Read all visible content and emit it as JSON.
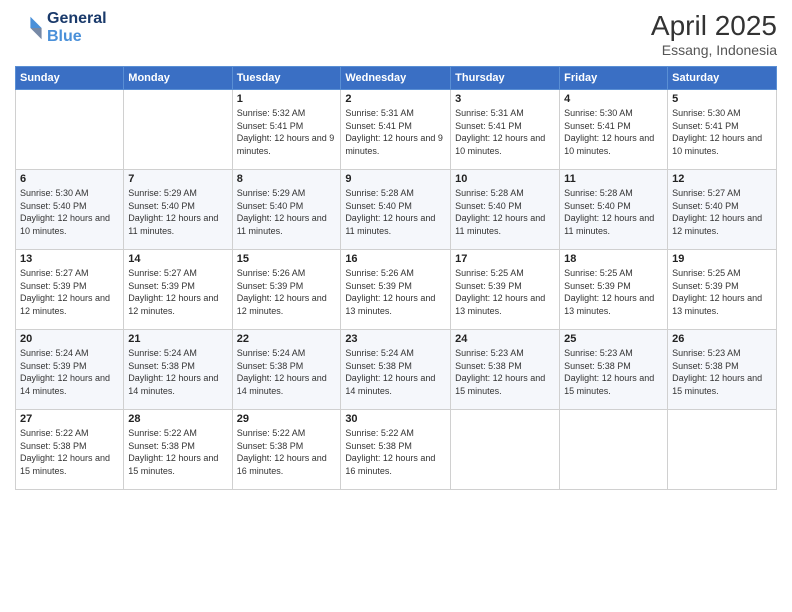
{
  "logo": {
    "line1": "General",
    "line2": "Blue"
  },
  "title": "April 2025",
  "subtitle": "Essang, Indonesia",
  "days_header": [
    "Sunday",
    "Monday",
    "Tuesday",
    "Wednesday",
    "Thursday",
    "Friday",
    "Saturday"
  ],
  "weeks": [
    [
      {
        "day": "",
        "sunrise": "",
        "sunset": "",
        "daylight": ""
      },
      {
        "day": "",
        "sunrise": "",
        "sunset": "",
        "daylight": ""
      },
      {
        "day": "1",
        "sunrise": "Sunrise: 5:32 AM",
        "sunset": "Sunset: 5:41 PM",
        "daylight": "Daylight: 12 hours and 9 minutes."
      },
      {
        "day": "2",
        "sunrise": "Sunrise: 5:31 AM",
        "sunset": "Sunset: 5:41 PM",
        "daylight": "Daylight: 12 hours and 9 minutes."
      },
      {
        "day": "3",
        "sunrise": "Sunrise: 5:31 AM",
        "sunset": "Sunset: 5:41 PM",
        "daylight": "Daylight: 12 hours and 10 minutes."
      },
      {
        "day": "4",
        "sunrise": "Sunrise: 5:30 AM",
        "sunset": "Sunset: 5:41 PM",
        "daylight": "Daylight: 12 hours and 10 minutes."
      },
      {
        "day": "5",
        "sunrise": "Sunrise: 5:30 AM",
        "sunset": "Sunset: 5:41 PM",
        "daylight": "Daylight: 12 hours and 10 minutes."
      }
    ],
    [
      {
        "day": "6",
        "sunrise": "Sunrise: 5:30 AM",
        "sunset": "Sunset: 5:40 PM",
        "daylight": "Daylight: 12 hours and 10 minutes."
      },
      {
        "day": "7",
        "sunrise": "Sunrise: 5:29 AM",
        "sunset": "Sunset: 5:40 PM",
        "daylight": "Daylight: 12 hours and 11 minutes."
      },
      {
        "day": "8",
        "sunrise": "Sunrise: 5:29 AM",
        "sunset": "Sunset: 5:40 PM",
        "daylight": "Daylight: 12 hours and 11 minutes."
      },
      {
        "day": "9",
        "sunrise": "Sunrise: 5:28 AM",
        "sunset": "Sunset: 5:40 PM",
        "daylight": "Daylight: 12 hours and 11 minutes."
      },
      {
        "day": "10",
        "sunrise": "Sunrise: 5:28 AM",
        "sunset": "Sunset: 5:40 PM",
        "daylight": "Daylight: 12 hours and 11 minutes."
      },
      {
        "day": "11",
        "sunrise": "Sunrise: 5:28 AM",
        "sunset": "Sunset: 5:40 PM",
        "daylight": "Daylight: 12 hours and 11 minutes."
      },
      {
        "day": "12",
        "sunrise": "Sunrise: 5:27 AM",
        "sunset": "Sunset: 5:40 PM",
        "daylight": "Daylight: 12 hours and 12 minutes."
      }
    ],
    [
      {
        "day": "13",
        "sunrise": "Sunrise: 5:27 AM",
        "sunset": "Sunset: 5:39 PM",
        "daylight": "Daylight: 12 hours and 12 minutes."
      },
      {
        "day": "14",
        "sunrise": "Sunrise: 5:27 AM",
        "sunset": "Sunset: 5:39 PM",
        "daylight": "Daylight: 12 hours and 12 minutes."
      },
      {
        "day": "15",
        "sunrise": "Sunrise: 5:26 AM",
        "sunset": "Sunset: 5:39 PM",
        "daylight": "Daylight: 12 hours and 12 minutes."
      },
      {
        "day": "16",
        "sunrise": "Sunrise: 5:26 AM",
        "sunset": "Sunset: 5:39 PM",
        "daylight": "Daylight: 12 hours and 13 minutes."
      },
      {
        "day": "17",
        "sunrise": "Sunrise: 5:25 AM",
        "sunset": "Sunset: 5:39 PM",
        "daylight": "Daylight: 12 hours and 13 minutes."
      },
      {
        "day": "18",
        "sunrise": "Sunrise: 5:25 AM",
        "sunset": "Sunset: 5:39 PM",
        "daylight": "Daylight: 12 hours and 13 minutes."
      },
      {
        "day": "19",
        "sunrise": "Sunrise: 5:25 AM",
        "sunset": "Sunset: 5:39 PM",
        "daylight": "Daylight: 12 hours and 13 minutes."
      }
    ],
    [
      {
        "day": "20",
        "sunrise": "Sunrise: 5:24 AM",
        "sunset": "Sunset: 5:39 PM",
        "daylight": "Daylight: 12 hours and 14 minutes."
      },
      {
        "day": "21",
        "sunrise": "Sunrise: 5:24 AM",
        "sunset": "Sunset: 5:38 PM",
        "daylight": "Daylight: 12 hours and 14 minutes."
      },
      {
        "day": "22",
        "sunrise": "Sunrise: 5:24 AM",
        "sunset": "Sunset: 5:38 PM",
        "daylight": "Daylight: 12 hours and 14 minutes."
      },
      {
        "day": "23",
        "sunrise": "Sunrise: 5:24 AM",
        "sunset": "Sunset: 5:38 PM",
        "daylight": "Daylight: 12 hours and 14 minutes."
      },
      {
        "day": "24",
        "sunrise": "Sunrise: 5:23 AM",
        "sunset": "Sunset: 5:38 PM",
        "daylight": "Daylight: 12 hours and 15 minutes."
      },
      {
        "day": "25",
        "sunrise": "Sunrise: 5:23 AM",
        "sunset": "Sunset: 5:38 PM",
        "daylight": "Daylight: 12 hours and 15 minutes."
      },
      {
        "day": "26",
        "sunrise": "Sunrise: 5:23 AM",
        "sunset": "Sunset: 5:38 PM",
        "daylight": "Daylight: 12 hours and 15 minutes."
      }
    ],
    [
      {
        "day": "27",
        "sunrise": "Sunrise: 5:22 AM",
        "sunset": "Sunset: 5:38 PM",
        "daylight": "Daylight: 12 hours and 15 minutes."
      },
      {
        "day": "28",
        "sunrise": "Sunrise: 5:22 AM",
        "sunset": "Sunset: 5:38 PM",
        "daylight": "Daylight: 12 hours and 15 minutes."
      },
      {
        "day": "29",
        "sunrise": "Sunrise: 5:22 AM",
        "sunset": "Sunset: 5:38 PM",
        "daylight": "Daylight: 12 hours and 16 minutes."
      },
      {
        "day": "30",
        "sunrise": "Sunrise: 5:22 AM",
        "sunset": "Sunset: 5:38 PM",
        "daylight": "Daylight: 12 hours and 16 minutes."
      },
      {
        "day": "",
        "sunrise": "",
        "sunset": "",
        "daylight": ""
      },
      {
        "day": "",
        "sunrise": "",
        "sunset": "",
        "daylight": ""
      },
      {
        "day": "",
        "sunrise": "",
        "sunset": "",
        "daylight": ""
      }
    ]
  ]
}
